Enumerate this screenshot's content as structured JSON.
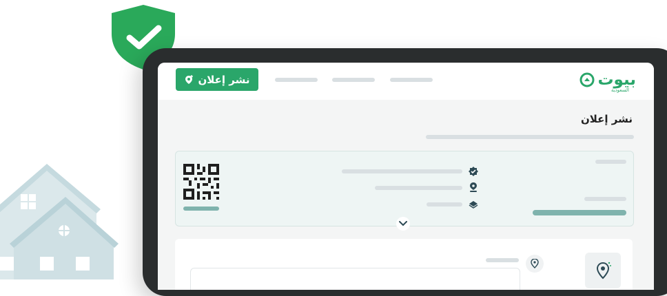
{
  "header": {
    "logo_text": "بيوت",
    "logo_subtext": "السعودية",
    "post_ad_button_label": "نشر إعلان"
  },
  "page": {
    "title": "نشر إعلان"
  },
  "icons": {
    "shield": "shield-check-icon",
    "qr": "qr-code-icon",
    "location": "location-pin-icon",
    "layers": "layers-icon",
    "verified": "verified-badge-icon",
    "chevron": "chevron-down-icon",
    "map_pin": "map-pin-icon"
  },
  "colors": {
    "brand_green": "#2aa66a",
    "shield_green": "#2aa95a",
    "teal_bar": "#7fb3ad",
    "placeholder_gray": "#d9dfe2",
    "house_blue": "#c5dadf"
  }
}
